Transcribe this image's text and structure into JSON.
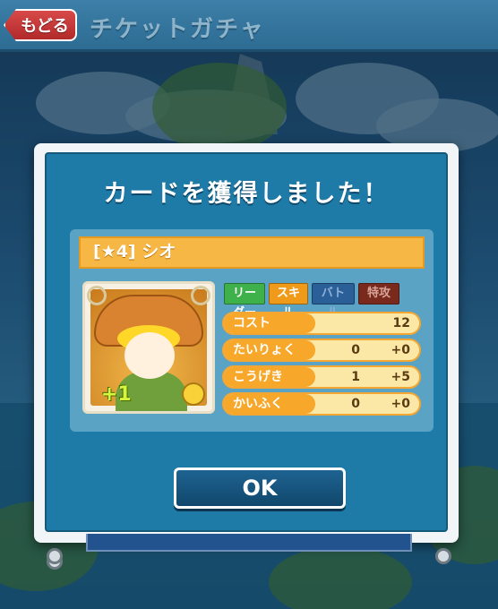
{
  "header": {
    "back_label": "もどる",
    "title": "チケットガチャ"
  },
  "dialog": {
    "title": "カードを獲得しました！",
    "card": {
      "name": "[★4] シオ",
      "plus_badge": "+1",
      "tags": {
        "leader": "リーダー",
        "skill": "スキル",
        "battle": "バトル",
        "special": "特攻"
      },
      "stats": {
        "cost": {
          "label": "コスト",
          "value": "12"
        },
        "hp": {
          "label": "たいりょく",
          "base": "0",
          "bonus": "+0"
        },
        "attack": {
          "label": "こうげき",
          "base": "1",
          "bonus": "+5"
        },
        "recovery": {
          "label": "かいふく",
          "base": "0",
          "bonus": "+0"
        }
      }
    },
    "ok_label": "OK"
  },
  "colors": {
    "panel_blue": "#1e7aa6",
    "name_bar": "#f7b744",
    "stat_label": "#f7a72a",
    "back_button": "#c83434",
    "ok_button": "#165479"
  }
}
